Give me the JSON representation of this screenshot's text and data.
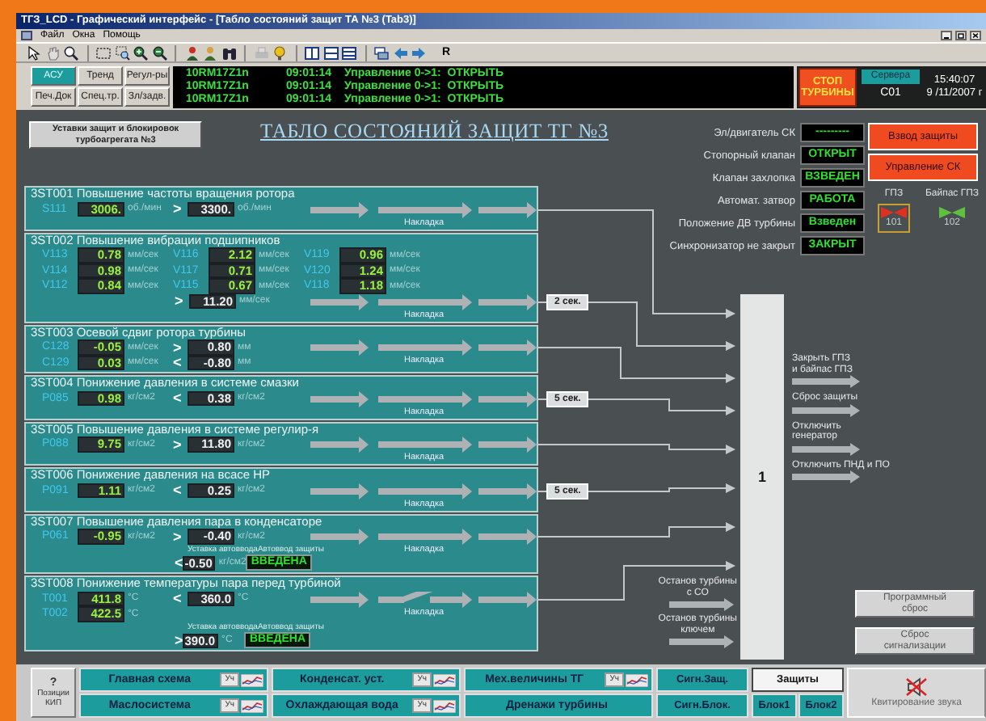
{
  "window": {
    "title": "ТГЗ_LCD - Графический интерфейс - [Табло состояний защит ТА №3 (Tab3)]"
  },
  "menu": [
    "Файл",
    "Окна",
    "Помощь"
  ],
  "toolbar": {
    "label": "R"
  },
  "mode_buttons": [
    {
      "label": "АСУ",
      "selected": true
    },
    {
      "label": "Тренд",
      "selected": false
    },
    {
      "label": "Регул-ры",
      "selected": false
    },
    {
      "label": "Печ.Док",
      "selected": false
    },
    {
      "label": "Спец.тр.",
      "selected": false
    },
    {
      "label": "Зл/задв.",
      "selected": false
    }
  ],
  "messages": [
    {
      "tag": "10RM17Z1n",
      "time": "09:01:14",
      "text": "Управление 0->1:  ОТКРЫТЬ"
    },
    {
      "tag": "10RM17Z1n",
      "time": "09:01:14",
      "text": "Управление 0->1:  ОТКРЫТЬ"
    },
    {
      "tag": "10RM17Z1n",
      "time": "09:01:14",
      "text": "Управление 0->1:  ОТКРЫТЬ"
    }
  ],
  "stop_button": {
    "lines": [
      "СТОП",
      "ТУРБИНЫ"
    ]
  },
  "server": {
    "label": "Сервера",
    "value": "С01"
  },
  "clock": {
    "time": "15:40:07",
    "date": "9 /11/2007 г"
  },
  "settings_button": {
    "lines": [
      "Уставки защит и блокировок",
      "турбоагрегата №3"
    ]
  },
  "title": "ТАБЛО СОСТОЯНИЙ ЗАЩИТ ТГ №3",
  "sections": [
    {
      "title": "3ST001 Повышение частоты вращения ротора",
      "bypass": "Накладка",
      "switch_closed": true,
      "rows": [
        [
          {
            "kind": "tag",
            "text": "S111"
          },
          {
            "kind": "value",
            "text": "3006."
          },
          {
            "kind": "unit",
            "text": "об./мин"
          },
          {
            "kind": "op",
            "text": ">"
          },
          {
            "kind": "setpoint",
            "text": "3300."
          },
          {
            "kind": "unit",
            "text": "об./мин"
          }
        ]
      ]
    },
    {
      "title": "3ST002 Повышение вибрации подшипников",
      "bypass": "Накладка",
      "switch_closed": true,
      "delay": "2 сек.",
      "rows": [
        [
          {
            "kind": "tag",
            "text": "V113"
          },
          {
            "kind": "value",
            "text": "0.78"
          },
          {
            "kind": "unit",
            "text": "мм/сек"
          },
          {
            "kind": "tag",
            "text": "V116"
          },
          {
            "kind": "value",
            "text": "2.12"
          },
          {
            "kind": "unit",
            "text": "мм/сек"
          },
          {
            "kind": "tag",
            "text": "V119"
          },
          {
            "kind": "value",
            "text": "0.96"
          },
          {
            "kind": "unit",
            "text": "мм/сек"
          }
        ],
        [
          {
            "kind": "tag",
            "text": "V114"
          },
          {
            "kind": "value",
            "text": "0.98"
          },
          {
            "kind": "unit",
            "text": "мм/сек"
          },
          {
            "kind": "tag",
            "text": "V117"
          },
          {
            "kind": "value",
            "text": "0.71"
          },
          {
            "kind": "unit",
            "text": "мм/сек"
          },
          {
            "kind": "tag",
            "text": "V120"
          },
          {
            "kind": "value",
            "text": "1.24"
          },
          {
            "kind": "unit",
            "text": "мм/сек"
          }
        ],
        [
          {
            "kind": "tag",
            "text": "V112"
          },
          {
            "kind": "value",
            "text": "0.84"
          },
          {
            "kind": "unit",
            "text": "мм/сек"
          },
          {
            "kind": "tag",
            "text": "V115"
          },
          {
            "kind": "value",
            "text": "0.67"
          },
          {
            "kind": "unit",
            "text": "мм/сек"
          },
          {
            "kind": "tag",
            "text": "V118"
          },
          {
            "kind": "value",
            "text": "1.18"
          },
          {
            "kind": "unit",
            "text": "мм/сек"
          }
        ]
      ],
      "threshold": {
        "op": ">",
        "setpoint": "11.20",
        "unit": "мм/сек"
      }
    },
    {
      "title": "3ST003 Осевой сдвиг ротора турбины",
      "bypass": "Накладка",
      "switch_closed": true,
      "rows": [
        [
          {
            "kind": "tag",
            "text": "C128"
          },
          {
            "kind": "value",
            "text": "-0.05"
          },
          {
            "kind": "unit",
            "text": "мм/сек"
          },
          {
            "kind": "op",
            "text": ">"
          },
          {
            "kind": "setpoint",
            "text": "0.80"
          },
          {
            "kind": "unit",
            "text": "мм"
          }
        ],
        [
          {
            "kind": "tag",
            "text": "C129"
          },
          {
            "kind": "value",
            "text": "0.03"
          },
          {
            "kind": "unit",
            "text": "мм/сек"
          },
          {
            "kind": "op",
            "text": "<"
          },
          {
            "kind": "setpoint",
            "text": "-0.80"
          },
          {
            "kind": "unit",
            "text": "мм"
          }
        ]
      ]
    },
    {
      "title": "3ST004 Понижение давления в системе смазки",
      "bypass": "Накладка",
      "switch_closed": true,
      "delay": "5 сек.",
      "rows": [
        [
          {
            "kind": "tag",
            "text": "P085"
          },
          {
            "kind": "value",
            "text": "0.98"
          },
          {
            "kind": "unit",
            "text": "кг/см2"
          },
          {
            "kind": "op",
            "text": "<"
          },
          {
            "kind": "setpoint",
            "text": "0.38"
          },
          {
            "kind": "unit",
            "text": "кг/см2"
          }
        ]
      ]
    },
    {
      "title": "3ST005 Повышение давления в системе регулир-я",
      "bypass": "Накладка",
      "switch_closed": true,
      "rows": [
        [
          {
            "kind": "tag",
            "text": "P088"
          },
          {
            "kind": "value",
            "text": "9.75"
          },
          {
            "kind": "unit",
            "text": "кг/см2"
          },
          {
            "kind": "op",
            "text": ">"
          },
          {
            "kind": "setpoint",
            "text": "11.80"
          },
          {
            "kind": "unit",
            "text": "кг/см2"
          }
        ]
      ]
    },
    {
      "title": "3ST006 Понижение давления на всасе НР",
      "bypass": "Накладка",
      "switch_closed": true,
      "delay": "5 сек.",
      "rows": [
        [
          {
            "kind": "tag",
            "text": "P091"
          },
          {
            "kind": "value",
            "text": "1.11"
          },
          {
            "kind": "unit",
            "text": "кг/см2"
          },
          {
            "kind": "op",
            "text": "<"
          },
          {
            "kind": "setpoint",
            "text": "0.25"
          },
          {
            "kind": "unit",
            "text": "кг/см2"
          }
        ]
      ]
    },
    {
      "title": "3ST007 Повышение давления пара в конденсаторе",
      "bypass": "Накладка",
      "switch_closed": true,
      "rows": [
        [
          {
            "kind": "tag",
            "text": "P061"
          },
          {
            "kind": "value",
            "text": "-0.95"
          },
          {
            "kind": "unit",
            "text": "кг/см2"
          },
          {
            "kind": "op",
            "text": ">"
          },
          {
            "kind": "setpoint",
            "text": "-0.40"
          },
          {
            "kind": "unit",
            "text": "кг/см2"
          }
        ]
      ],
      "autoinput": {
        "setpoint_caption": "Уставка автоввода",
        "status_caption": "Автоввод защиты",
        "op": "<",
        "setpoint": "-0.50",
        "unit": "кг/см2",
        "status": "ВВЕДЕНА"
      }
    },
    {
      "title": "3ST008 Понижение температуры пара перед турбиной",
      "bypass": "Накладка",
      "switch_closed": false,
      "rows": [
        [
          {
            "kind": "tag",
            "text": "T001"
          },
          {
            "kind": "value",
            "text": "411.8"
          },
          {
            "kind": "unit",
            "text": "°C"
          },
          {
            "kind": "op",
            "text": "<"
          },
          {
            "kind": "setpoint",
            "text": "360.0"
          },
          {
            "kind": "unit",
            "text": "°C"
          }
        ],
        [
          {
            "kind": "tag",
            "text": "T002"
          },
          {
            "kind": "value",
            "text": "422.5"
          },
          {
            "kind": "unit",
            "text": "°C"
          }
        ]
      ],
      "autoinput": {
        "setpoint_caption": "Уставка автоввода",
        "status_caption": "Автоввод защиты",
        "op": ">",
        "setpoint": "390.0",
        "unit": "°C",
        "status": "ВВЕДЕНА"
      }
    }
  ],
  "status": [
    {
      "label": "Эл/двигатель СК",
      "value": "---------"
    },
    {
      "label": "Стопорный клапан",
      "value": "ОТКРЫТ"
    },
    {
      "label": "Клапан захлопка",
      "value": "ВЗВЕДЕН"
    },
    {
      "label": "Автомат. затвор",
      "value": "РАБОТА"
    },
    {
      "label": "Положение ДВ турбины",
      "value": "Взведен"
    },
    {
      "label": "Синхронизатор не закрыт",
      "value": "ЗАКРЫТ"
    }
  ],
  "control_buttons": [
    "Взвод защиты",
    "Управление СК"
  ],
  "valves": [
    {
      "label": "ГПЗ",
      "number": "101",
      "color": "#e03020",
      "selected": true
    },
    {
      "label": "Байпас ГПЗ",
      "number": "102",
      "color": "#60c040",
      "selected": false
    }
  ],
  "logic_block": "1",
  "outputs": [
    "Закрыть ГПЗ\nи байпас ГПЗ",
    "Сброс защиты",
    "Отключить\nгенератор",
    "Отключить ПНД и ПО"
  ],
  "extra_inputs": [
    "Останов турбины\nс СО",
    "Останов турбины\nключем"
  ],
  "reset_buttons": [
    {
      "lines": [
        "Программный",
        "сброс"
      ]
    },
    {
      "lines": [
        "Сброс",
        "сигнализации"
      ]
    }
  ],
  "bottom": {
    "help": {
      "symbol": "?",
      "lines": [
        "Позиции",
        "КИП"
      ]
    },
    "nav": [
      {
        "label": "Главная схема",
        "badge": "Уч",
        "trend": true
      },
      {
        "label": "Конденсат. уст.",
        "badge": "Уч",
        "trend": true
      },
      {
        "label": "Мех.величины ТГ",
        "badge": "Уч",
        "trend": true
      },
      {
        "label": "Маслосистема",
        "badge": "Уч",
        "trend": true
      },
      {
        "label": "Охлаждающая вода",
        "badge": "Уч",
        "trend": true
      },
      {
        "label": "Дренажи турбины",
        "trend": false
      }
    ],
    "signals": [
      "Сигн.Защ.",
      "Сигн.Блок."
    ],
    "screens": [
      {
        "label": "Защиты",
        "selected": true
      },
      {
        "label": "Блок1",
        "selected": false
      },
      {
        "label": "Блок2",
        "selected": false
      }
    ],
    "mute": {
      "label": "Квитирование звука"
    }
  }
}
